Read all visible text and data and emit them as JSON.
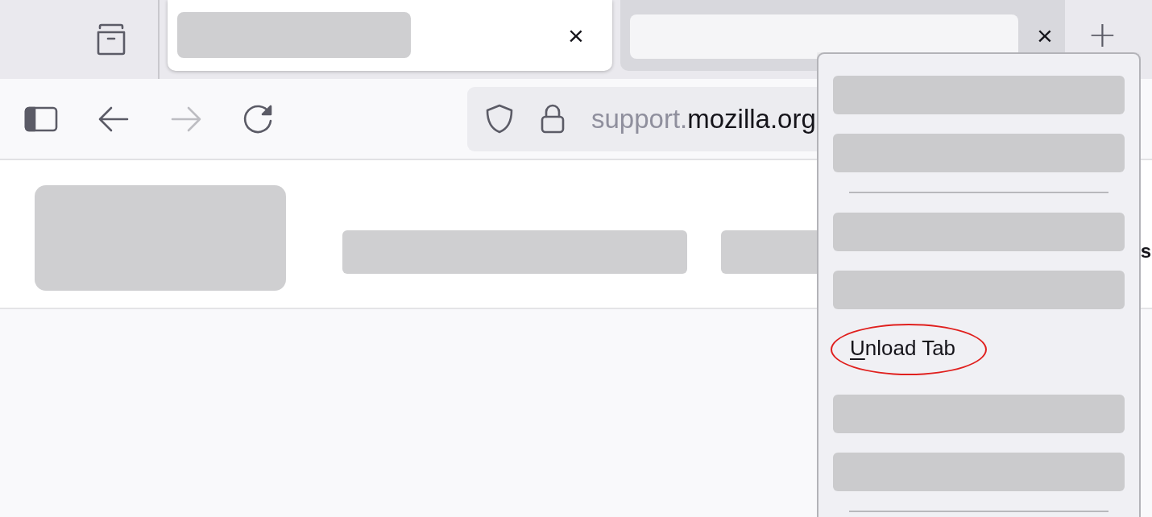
{
  "tab_strip": {
    "tabs": [
      {
        "kind": "redacted",
        "selected": true,
        "close": "×"
      },
      {
        "kind": "redacted",
        "selected": false,
        "close": "×"
      }
    ],
    "new_tab": "+"
  },
  "toolbar": {
    "back_enabled": true,
    "forward_enabled": false,
    "url": {
      "subdomain": "support.",
      "domain": "mozilla.org"
    }
  },
  "page": {
    "header": [
      {
        "kind": "logo"
      },
      {
        "kind": "bar"
      },
      {
        "kind": "bar"
      }
    ],
    "cut_text": "s"
  },
  "context_menu": {
    "items": [
      {
        "kind": "redacted"
      },
      {
        "kind": "redacted"
      },
      {
        "kind": "separator"
      },
      {
        "kind": "redacted"
      },
      {
        "kind": "redacted"
      },
      {
        "kind": "item",
        "label_parts": [
          {
            "text": "U",
            "underlined": true
          },
          {
            "text": "nload Tab",
            "underlined": false
          }
        ],
        "highlighted": true
      },
      {
        "kind": "redacted"
      },
      {
        "kind": "redacted"
      },
      {
        "kind": "separator"
      }
    ]
  }
}
